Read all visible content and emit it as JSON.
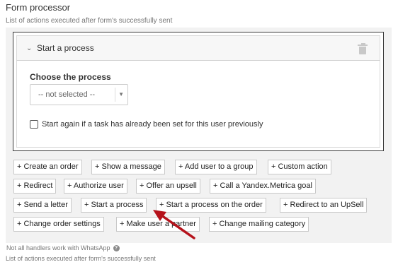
{
  "header": {
    "title": "Form processor",
    "subtitle": "List of actions executed after form's successfully sent"
  },
  "action_card": {
    "title": "Start a process",
    "collapse_icon": "chevron-down-icon",
    "delete_icon": "trash-icon",
    "choose_label": "Choose the process",
    "select_value": "-- not selected --",
    "checkbox_label": "Start again if a task has already been set for this user previously",
    "checkbox_checked": false
  },
  "action_buttons": [
    "+ Create an order",
    "+ Show a message",
    "+ Add user to a group",
    "+ Custom action",
    "+ Redirect",
    "+ Authorize user",
    "+ Offer an upsell",
    "+ Call a Yandex.Metrica goal",
    "+ Send a letter",
    "+ Start a process",
    "+ Start a process on the order",
    "+ Redirect to an UpSell",
    "+ Change order settings",
    "+ Make user a partner",
    "+ Change mailing category"
  ],
  "footer": {
    "note": "Not all handlers work with WhatsApp",
    "note_icon": "help-icon",
    "subtitle": "List of actions executed after form's successfully sent"
  },
  "annotation": {
    "color": "#b5121b",
    "points_to": "+ Start a process"
  }
}
